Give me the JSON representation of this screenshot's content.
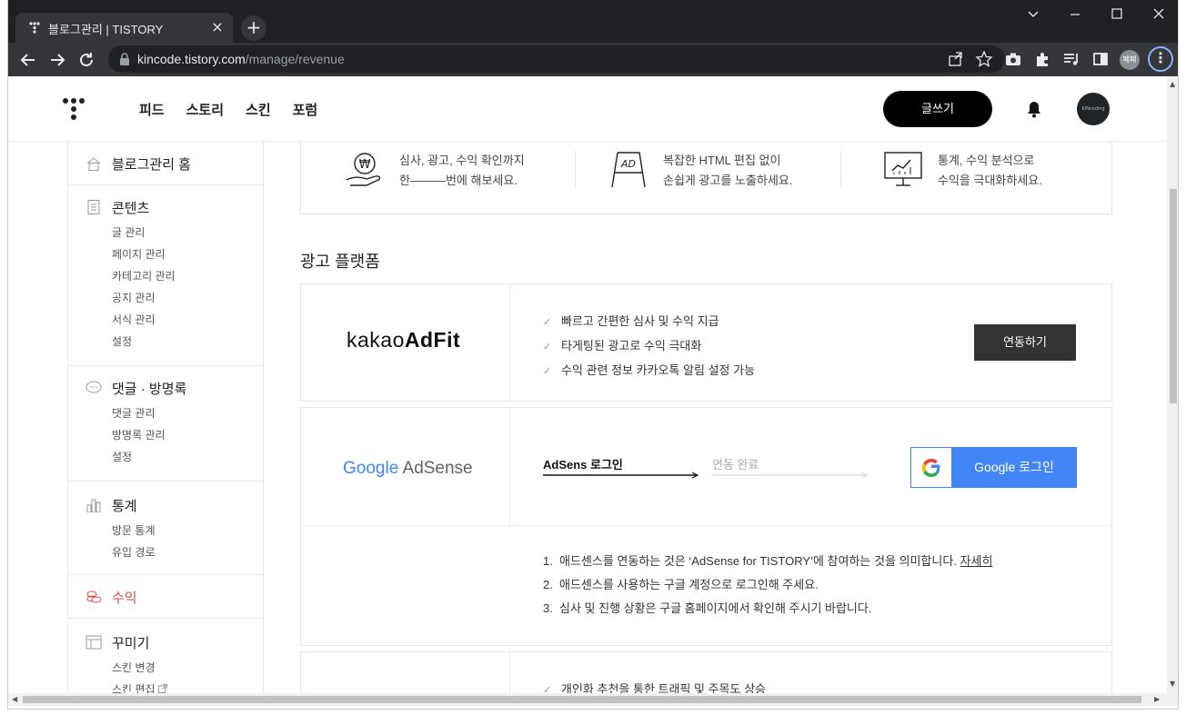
{
  "browser": {
    "tab_title": "블로그관리 | TISTORY",
    "tab_close": "×",
    "new_tab": "+",
    "url_domain": "kincode.tistory.com",
    "url_path": "/manage/revenue",
    "profile_label": "폐폐",
    "menu_glyph": "⋮"
  },
  "gnb": {
    "menu": [
      "피드",
      "스토리",
      "스킨",
      "포럼"
    ],
    "write_label": "글쓰기",
    "avatar_label": "KINcoding"
  },
  "sidebar": {
    "home": "블로그관리 홈",
    "sections": [
      {
        "title": "콘텐츠",
        "icon": "document-icon",
        "items": [
          "글 관리",
          "페이지 관리",
          "카테고리 관리",
          "공지 관리",
          "서식 관리",
          "설정"
        ]
      },
      {
        "title": "댓글 · 방명록",
        "icon": "speech-bubble-icon",
        "items": [
          "댓글 관리",
          "방명록 관리",
          "설정"
        ]
      },
      {
        "title": "통계",
        "icon": "bar-chart-icon",
        "items": [
          "방문 통계",
          "유입 경로"
        ]
      },
      {
        "title": "수익",
        "icon": "coins-icon",
        "items": []
      },
      {
        "title": "꾸미기",
        "icon": "layout-icon",
        "items": [
          "스킨 변경",
          "스킨 편집"
        ]
      }
    ],
    "active_color": "#e3463b"
  },
  "intro": [
    {
      "icon": "won-hand-icon",
      "line1": "심사, 광고, 수익 확인까지",
      "line2": "한———번에 해보세요."
    },
    {
      "icon": "ad-board-icon",
      "line1": "복잡한 HTML 편집 없이",
      "line2": "손쉽게 광고를 노출하세요."
    },
    {
      "icon": "monitor-chart-icon",
      "line1": "통계, 수익 분석으로",
      "line2": "수익을 극대화하세요."
    }
  ],
  "section_title": "광고 플랫폼",
  "adfit": {
    "logo_light": "kakao",
    "logo_bold": "AdFit",
    "features": [
      "빠르고 간편한 심사 및 수익 지급",
      "타게팅된 광고로 수익 극대화",
      "수익 관련 정보 카카오톡 알림 설정 가능"
    ],
    "button": "연동하기"
  },
  "adsense": {
    "logo_google": "Google",
    "logo_product": "AdSense",
    "step1": "AdSens 로그인",
    "step2": "연동 완료",
    "button": "Google 로그인",
    "notes": [
      {
        "num": "1.",
        "text": "애드센스를 연동하는 것은 ‘AdSense for TISTORY’에 참여하는 것을 의미합니다. ",
        "link": "자세히"
      },
      {
        "num": "2.",
        "text": "애드센스를 사용하는 구글 계정으로 로그인해 주세요."
      },
      {
        "num": "3.",
        "text": "심사 및 진행 상황은 구글 홈페이지에서 확인해 주시기 바랍니다."
      }
    ]
  },
  "third": {
    "feature": "개인화 추천을 통한 트래픽 및 주목도 상승"
  }
}
